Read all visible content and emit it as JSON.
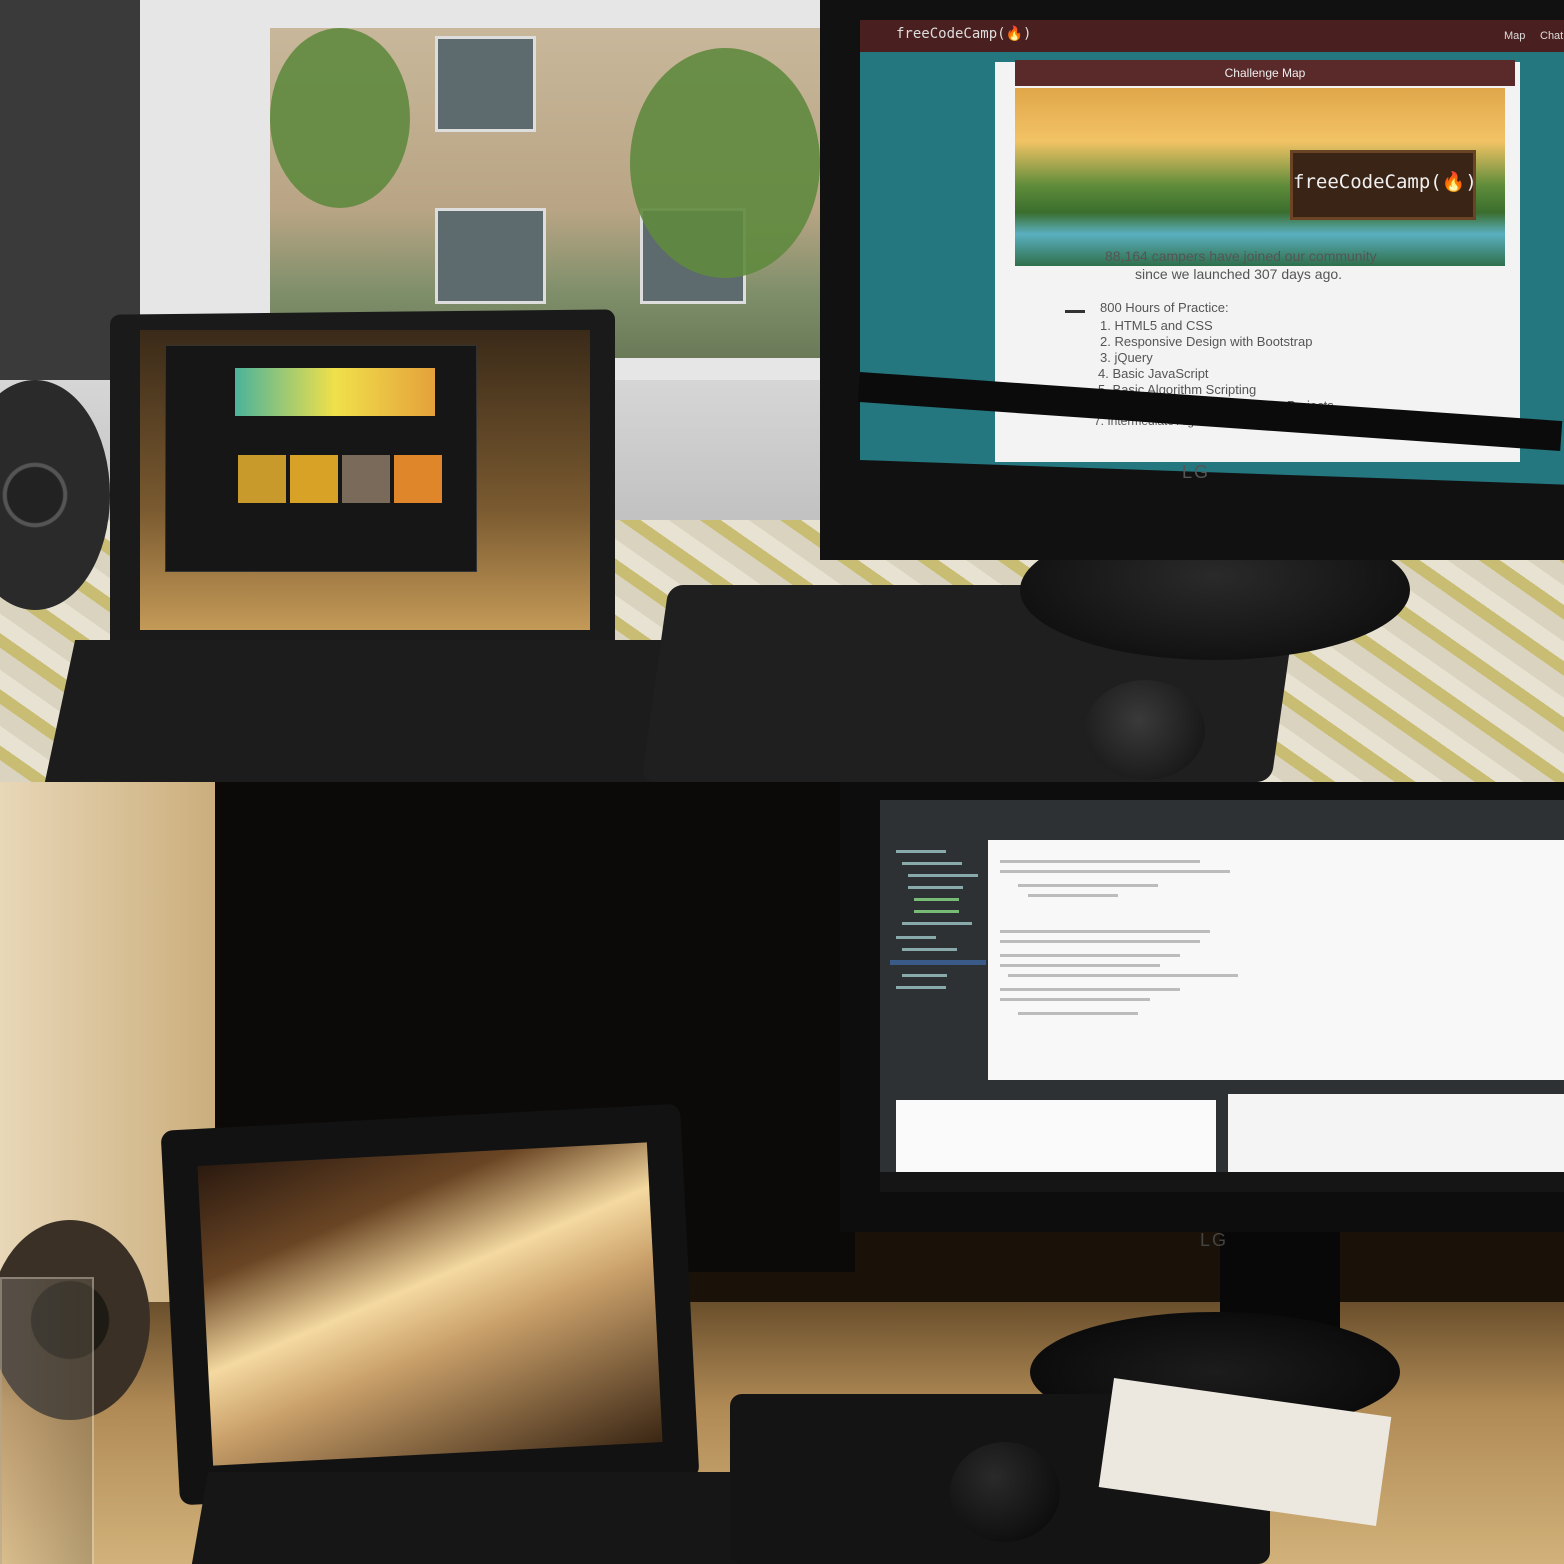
{
  "top_scene": {
    "monitor_site": {
      "logo": "freeCodeCamp(🔥)",
      "nav": [
        "Map",
        "Chat"
      ],
      "card_title": "Challenge Map",
      "banner_sign": "freeCodeCamp(🔥)",
      "stats_line1": "88,164 campers have joined our community",
      "stats_line2": "since we launched 307 days ago.",
      "list_header": "800 Hours of Practice:",
      "list_items": [
        "1. HTML5 and CSS",
        "2. Responsive Design with Bootstrap",
        "3. jQuery",
        "4. Basic JavaScript",
        "5. Basic Algorithm Scripting",
        "6. Basic Front End Development Projects",
        "7. Intermediate Algorithm Scripting"
      ]
    },
    "monitor_brand": "LG",
    "tablet_app": {
      "hero_label": "",
      "cards": [
        {
          "color": "#c89a2c"
        },
        {
          "color": "#d8a227"
        },
        {
          "color": "#7a6a5a"
        },
        {
          "color": "#e0862a"
        }
      ]
    }
  },
  "bottom_scene": {
    "monitor_brand": "LG",
    "ide": {
      "editor_bg": "#f8f8f8",
      "theme_bg": "#2d3134"
    }
  },
  "colors": {
    "fcc_teal": "#24767f",
    "fcc_header": "#4a1f1f"
  }
}
